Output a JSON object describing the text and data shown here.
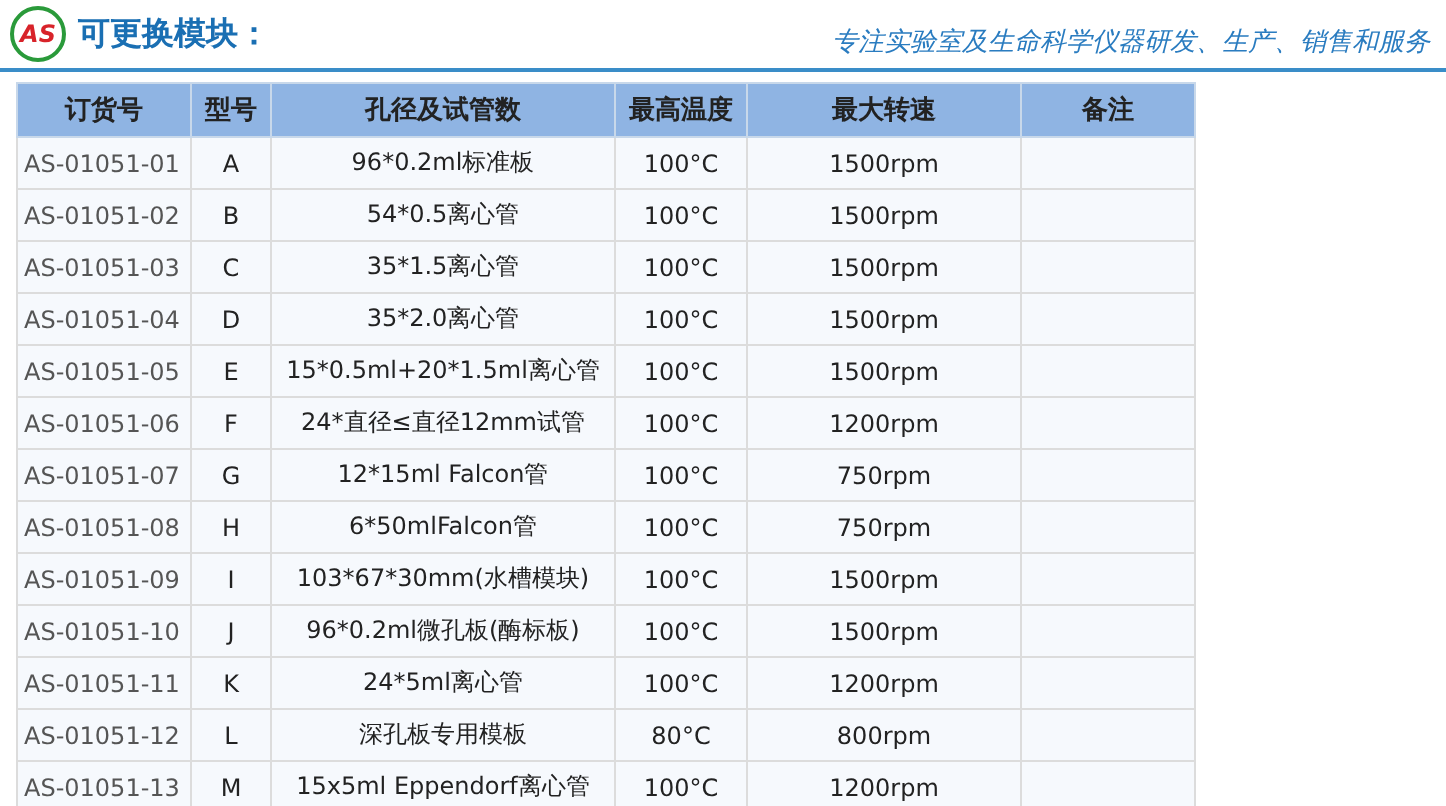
{
  "header": {
    "logo": "AS",
    "title": "可更换模块：",
    "slogan": "专注实验室及生命科学仪器研发、生产、销售和服务"
  },
  "table": {
    "columns": [
      "订货号",
      "型号",
      "孔径及试管数",
      "最高温度",
      "最大转速",
      "备注"
    ],
    "rows": [
      [
        "AS-01051-01",
        "A",
        "96*0.2ml标准板",
        "100°C",
        "1500rpm"
      ],
      [
        "AS-01051-02",
        "B",
        "54*0.5离心管",
        "100°C",
        "1500rpm"
      ],
      [
        "AS-01051-03",
        "C",
        "35*1.5离心管",
        "100°C",
        "1500rpm"
      ],
      [
        "AS-01051-04",
        "D",
        "35*2.0离心管",
        "100°C",
        "1500rpm"
      ],
      [
        "AS-01051-05",
        "E",
        "15*0.5ml+20*1.5ml离心管",
        "100°C",
        "1500rpm"
      ],
      [
        "AS-01051-06",
        "F",
        "24*直径≤直径12mm试管",
        "100°C",
        "1200rpm"
      ],
      [
        "AS-01051-07",
        "G",
        "12*15ml Falcon管",
        "100°C",
        "750rpm"
      ],
      [
        "AS-01051-08",
        "H",
        "6*50mlFalcon管",
        "100°C",
        "750rpm"
      ],
      [
        "AS-01051-09",
        "I",
        "103*67*30mm(水槽模块)",
        "100°C",
        "1500rpm"
      ],
      [
        "AS-01051-10",
        "J",
        "96*0.2ml微孔板(酶标板)",
        "100°C",
        "1500rpm"
      ],
      [
        "AS-01051-11",
        "K",
        "24*5ml离心管",
        "100°C",
        "1200rpm"
      ],
      [
        "AS-01051-12",
        "L",
        "深孔板专用模板",
        "80°C",
        "800rpm"
      ],
      [
        "AS-01051-13",
        "M",
        "15x5ml Eppendorf离心管",
        "100°C",
        "1200rpm"
      ]
    ]
  }
}
